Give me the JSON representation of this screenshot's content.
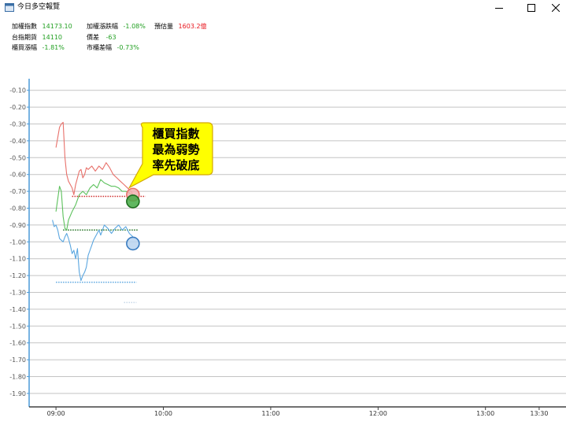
{
  "window": {
    "title": "今日多空報覽",
    "icons": [
      "app-icon",
      "minimize-icon",
      "maximize-icon",
      "close-icon"
    ]
  },
  "info": {
    "taiex_label": "加權指數",
    "taiex_value": "14173.10",
    "taiex_change_label": "加權漲跌幅",
    "taiex_change_value": "-1.08%",
    "est_volume_label": "預估量",
    "est_volume_value": "1603.2億",
    "futures_label": "台指期貨",
    "futures_value": "14110",
    "basis_label": "價差",
    "basis_value": "-63",
    "otc_change_label": "櫃買漲幅",
    "otc_change_value": "-1.81%",
    "market_diff_label": "市櫃差幅",
    "market_diff_value": "-0.73%"
  },
  "colors": {
    "red_series": "#e8706a",
    "green_series": "#5cc15c",
    "blue_series": "#5aa6e0",
    "value_green": "#22a022",
    "value_red": "#e8141c",
    "callout_fill": "#ffff00",
    "callout_border": "#d4a800"
  },
  "chart_data": {
    "type": "line",
    "x_unit": "time",
    "xlim": [
      "08:45",
      "13:45"
    ],
    "x_ticks": [
      "09:00",
      "10:00",
      "11:00",
      "12:00",
      "13:00",
      "13:30"
    ],
    "ylim": [
      -1.98,
      -0.05
    ],
    "y_ticks": [
      "-0.10",
      "-0.20",
      "-0.30",
      "-0.40",
      "-0.50",
      "-0.60",
      "-0.70",
      "-0.80",
      "-0.90",
      "-1.00",
      "-1.10",
      "-1.20",
      "-1.30",
      "-1.40",
      "-1.50",
      "-1.60",
      "-1.70",
      "-1.80",
      "-1.90"
    ],
    "grid": true,
    "series": [
      {
        "color": "#e8706a",
        "points": [
          [
            "09:00",
            -0.44
          ],
          [
            "09:01",
            -0.38
          ],
          [
            "09:02",
            -0.32
          ],
          [
            "09:03",
            -0.3
          ],
          [
            "09:04",
            -0.29
          ],
          [
            "09:05",
            -0.5
          ],
          [
            "09:06",
            -0.6
          ],
          [
            "09:07",
            -0.64
          ],
          [
            "09:08",
            -0.66
          ],
          [
            "09:09",
            -0.68
          ],
          [
            "09:10",
            -0.72
          ],
          [
            "09:11",
            -0.66
          ],
          [
            "09:12",
            -0.62
          ],
          [
            "09:13",
            -0.58
          ],
          [
            "09:14",
            -0.57
          ],
          [
            "09:15",
            -0.62
          ],
          [
            "09:16",
            -0.6
          ],
          [
            "09:17",
            -0.56
          ],
          [
            "09:18",
            -0.57
          ],
          [
            "09:20",
            -0.55
          ],
          [
            "09:22",
            -0.58
          ],
          [
            "09:24",
            -0.55
          ],
          [
            "09:26",
            -0.57
          ],
          [
            "09:28",
            -0.53
          ],
          [
            "09:30",
            -0.56
          ],
          [
            "09:32",
            -0.6
          ],
          [
            "09:34",
            -0.62
          ],
          [
            "09:36",
            -0.64
          ],
          [
            "09:38",
            -0.66
          ],
          [
            "09:40",
            -0.68
          ],
          [
            "09:42",
            -0.7
          ],
          [
            "09:43",
            -0.72
          ]
        ]
      },
      {
        "color": "#5cc15c",
        "points": [
          [
            "09:00",
            -0.82
          ],
          [
            "09:02",
            -0.67
          ],
          [
            "09:03",
            -0.7
          ],
          [
            "09:04",
            -0.85
          ],
          [
            "09:05",
            -0.92
          ],
          [
            "09:06",
            -0.93
          ],
          [
            "09:07",
            -0.87
          ],
          [
            "09:09",
            -0.82
          ],
          [
            "09:11",
            -0.78
          ],
          [
            "09:13",
            -0.72
          ],
          [
            "09:15",
            -0.7
          ],
          [
            "09:17",
            -0.72
          ],
          [
            "09:19",
            -0.68
          ],
          [
            "09:21",
            -0.66
          ],
          [
            "09:23",
            -0.68
          ],
          [
            "09:25",
            -0.63
          ],
          [
            "09:27",
            -0.65
          ],
          [
            "09:29",
            -0.66
          ],
          [
            "09:31",
            -0.67
          ],
          [
            "09:33",
            -0.67
          ],
          [
            "09:35",
            -0.68
          ],
          [
            "09:37",
            -0.7
          ],
          [
            "09:39",
            -0.7
          ],
          [
            "09:41",
            -0.71
          ],
          [
            "09:43",
            -0.72
          ]
        ]
      },
      {
        "color": "#5aa6e0",
        "points": [
          [
            "08:58",
            -0.87
          ],
          [
            "08:59",
            -0.91
          ],
          [
            "09:00",
            -0.9
          ],
          [
            "09:01",
            -0.93
          ],
          [
            "09:02",
            -0.98
          ],
          [
            "09:03",
            -0.99
          ],
          [
            "09:04",
            -1.0
          ],
          [
            "09:05",
            -0.97
          ],
          [
            "09:06",
            -0.95
          ],
          [
            "09:07",
            -0.98
          ],
          [
            "09:08",
            -1.02
          ],
          [
            "09:09",
            -1.07
          ],
          [
            "09:10",
            -1.05
          ],
          [
            "09:11",
            -1.1
          ],
          [
            "09:12",
            -1.04
          ],
          [
            "09:13",
            -1.18
          ],
          [
            "09:14",
            -1.23
          ],
          [
            "09:15",
            -1.2
          ],
          [
            "09:16",
            -1.18
          ],
          [
            "09:17",
            -1.15
          ],
          [
            "09:18",
            -1.08
          ],
          [
            "09:19",
            -1.05
          ],
          [
            "09:20",
            -1.02
          ],
          [
            "09:21",
            -0.99
          ],
          [
            "09:22",
            -0.97
          ],
          [
            "09:23",
            -0.95
          ],
          [
            "09:24",
            -0.93
          ],
          [
            "09:25",
            -0.96
          ],
          [
            "09:27",
            -0.9
          ],
          [
            "09:29",
            -0.92
          ],
          [
            "09:31",
            -0.95
          ],
          [
            "09:33",
            -0.92
          ],
          [
            "09:35",
            -0.9
          ],
          [
            "09:37",
            -0.93
          ],
          [
            "09:39",
            -0.91
          ],
          [
            "09:41",
            -0.95
          ],
          [
            "09:43",
            -0.97
          ]
        ]
      }
    ],
    "reference_lines": [
      {
        "color": "#d03030",
        "y": -0.73,
        "x_start": "09:09",
        "x_end": "09:50"
      },
      {
        "color": "#207020",
        "y": -0.93,
        "x_start": "09:04",
        "x_end": "09:46"
      },
      {
        "color": "#5aa6e0",
        "y": -1.24,
        "x_start": "09:00",
        "x_end": "09:45"
      },
      {
        "color": "#c8d8e8",
        "y": -1.36,
        "x_start": "09:38",
        "x_end": "09:45"
      }
    ],
    "markers": [
      {
        "color": "#e8706a",
        "fill": "#f2b0b0",
        "x": "09:43",
        "y": -0.72
      },
      {
        "color": "#207020",
        "fill": "#44aa44",
        "x": "09:43",
        "y": -0.76
      },
      {
        "color": "#3a7cc0",
        "fill": "#b8d4f0",
        "x": "09:43",
        "y": -1.01
      }
    ],
    "annotation": {
      "lines": [
        "櫃買指數",
        "最為弱勢",
        "率先破底"
      ],
      "anchor_x": "09:41",
      "anchor_y": -0.72
    }
  }
}
